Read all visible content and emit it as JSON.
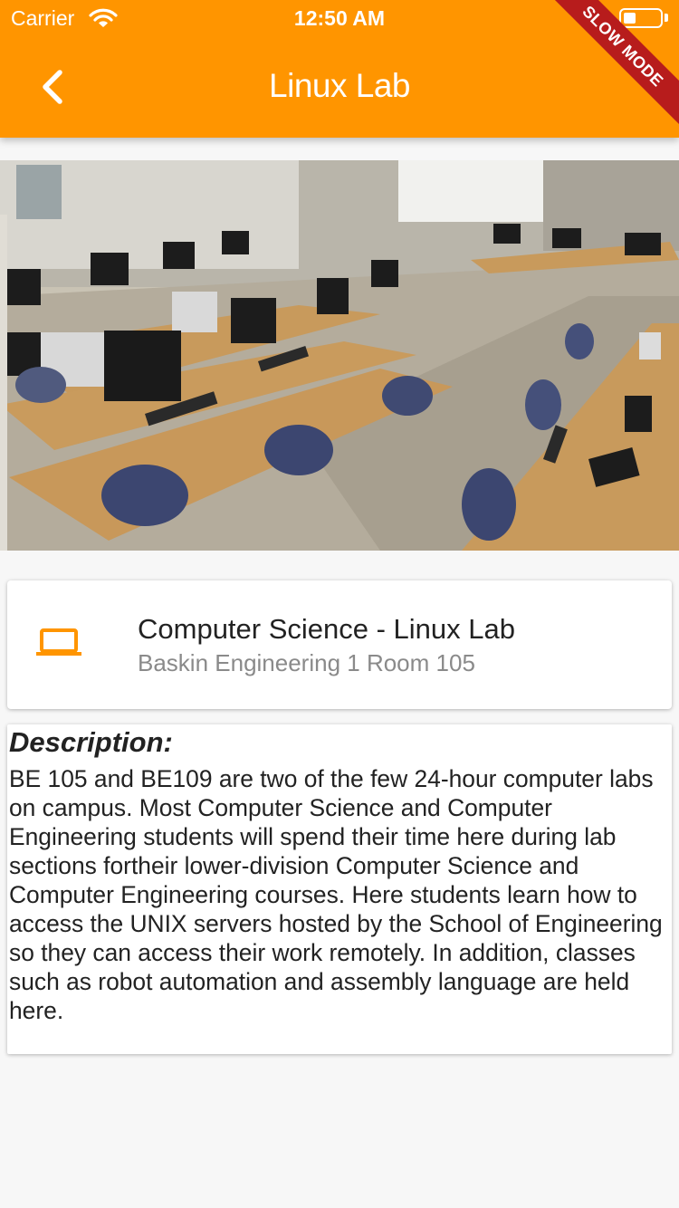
{
  "status_bar": {
    "carrier": "Carrier",
    "time": "12:50 AM"
  },
  "app_bar": {
    "title": "Linux Lab",
    "back_icon": "chevron-left-icon",
    "color": "#ff9500"
  },
  "debug_banner": {
    "label": "SLOW MODE",
    "color": "#b71c1c"
  },
  "photo": {
    "subject": "computer lab photo"
  },
  "location_card": {
    "icon": "laptop-icon",
    "title": "Computer Science - Linux Lab",
    "subtitle": "Baskin Engineering 1 Room 105"
  },
  "description": {
    "heading": "Description:",
    "body": "BE 105 and BE109 are two of the few 24-hour computer labs on campus. Most Computer Science and Computer Engineering students will spend their time here during lab sections fortheir lower-division Computer Science and Computer Engineering courses. Here students learn how to access the UNIX servers hosted by the School of Engineering so they can access their work remotely. In addition, classes such as robot automation and assembly language are held here."
  }
}
